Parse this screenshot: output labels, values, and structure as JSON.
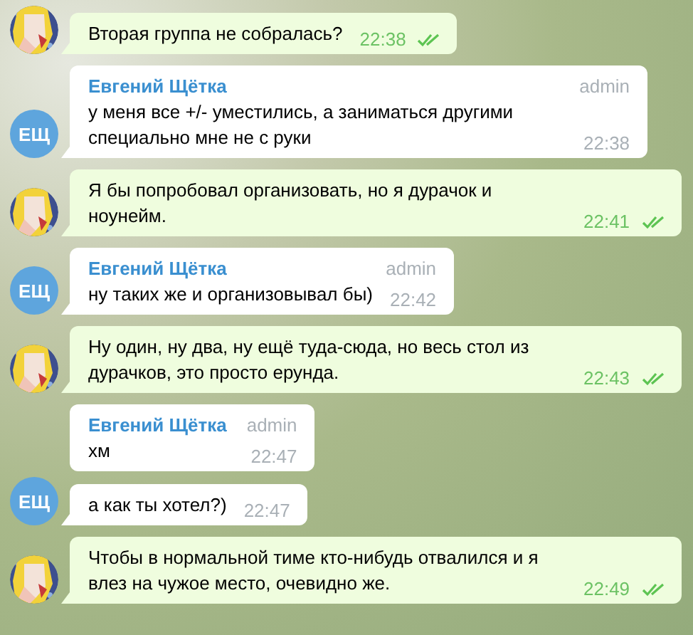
{
  "messages": [
    {
      "kind": "mine",
      "text": "Вторая группа не собралась?",
      "time": "22:38",
      "read": true
    },
    {
      "kind": "other",
      "sender": "Евгений Щётка",
      "badge": "admin",
      "text": "у меня все +/- уместились, а заниматься другими специально мне не с руки",
      "time": "22:38",
      "avatar": {
        "kind": "initials",
        "text": "ЕЩ"
      }
    },
    {
      "kind": "mine",
      "text": "Я бы попробовал организовать, но я дурачок и ноунейм.",
      "time": "22:41",
      "read": true
    },
    {
      "kind": "other",
      "sender": "Евгений Щётка",
      "badge": "admin",
      "text": "ну таких же и организовывал бы)",
      "time": "22:42",
      "avatar": {
        "kind": "initials",
        "text": "ЕЩ"
      }
    },
    {
      "kind": "mine",
      "text": "Ну один, ну два, ну ещё туда-сюда, но весь стол из дурачков, это просто ерунда.",
      "time": "22:43",
      "read": true
    },
    {
      "kind": "other",
      "sender": "Евгений Щётка",
      "badge": "admin",
      "text": "хм",
      "time": "22:47"
    },
    {
      "kind": "other",
      "text": "а как ты хотел?)",
      "time": "22:47",
      "avatar": {
        "kind": "initials",
        "text": "ЕЩ"
      }
    },
    {
      "kind": "mine",
      "text": "Чтобы в нормальной тиме кто-нибудь отвалился и я влез на чужое место, очевидно же.",
      "time": "22:49",
      "read": true
    }
  ]
}
